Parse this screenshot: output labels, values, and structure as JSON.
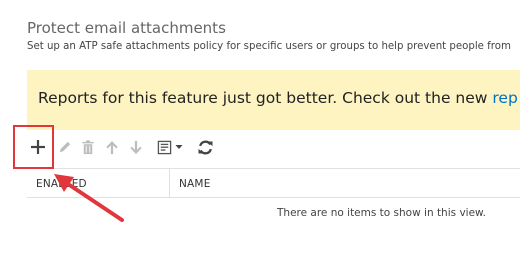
{
  "header": {
    "title": "Protect email attachments",
    "description": "Set up an ATP safe attachments policy for specific users or groups to help prevent people from"
  },
  "banner": {
    "text": "Reports for this feature just got better. Check out the new ",
    "link": "rep"
  },
  "toolbar": {
    "buttons": [
      {
        "icon": "plus-icon",
        "enabled": true
      },
      {
        "icon": "pencil-icon",
        "enabled": false
      },
      {
        "icon": "trash-icon",
        "enabled": false
      },
      {
        "icon": "arrow-up-icon",
        "enabled": false
      },
      {
        "icon": "arrow-down-icon",
        "enabled": false
      },
      {
        "icon": "export-icon",
        "enabled": false
      },
      {
        "icon": "refresh-icon",
        "enabled": true
      }
    ]
  },
  "grid": {
    "columns": [
      "ENABLED",
      "NAME"
    ],
    "empty_message": "There are no items to show in this view."
  },
  "colors": {
    "banner_background": "#fdf4c2",
    "link": "#0072c6",
    "annotation": "#e0363c",
    "icon_active": "#444444",
    "icon_disabled": "#bdbdbd"
  }
}
